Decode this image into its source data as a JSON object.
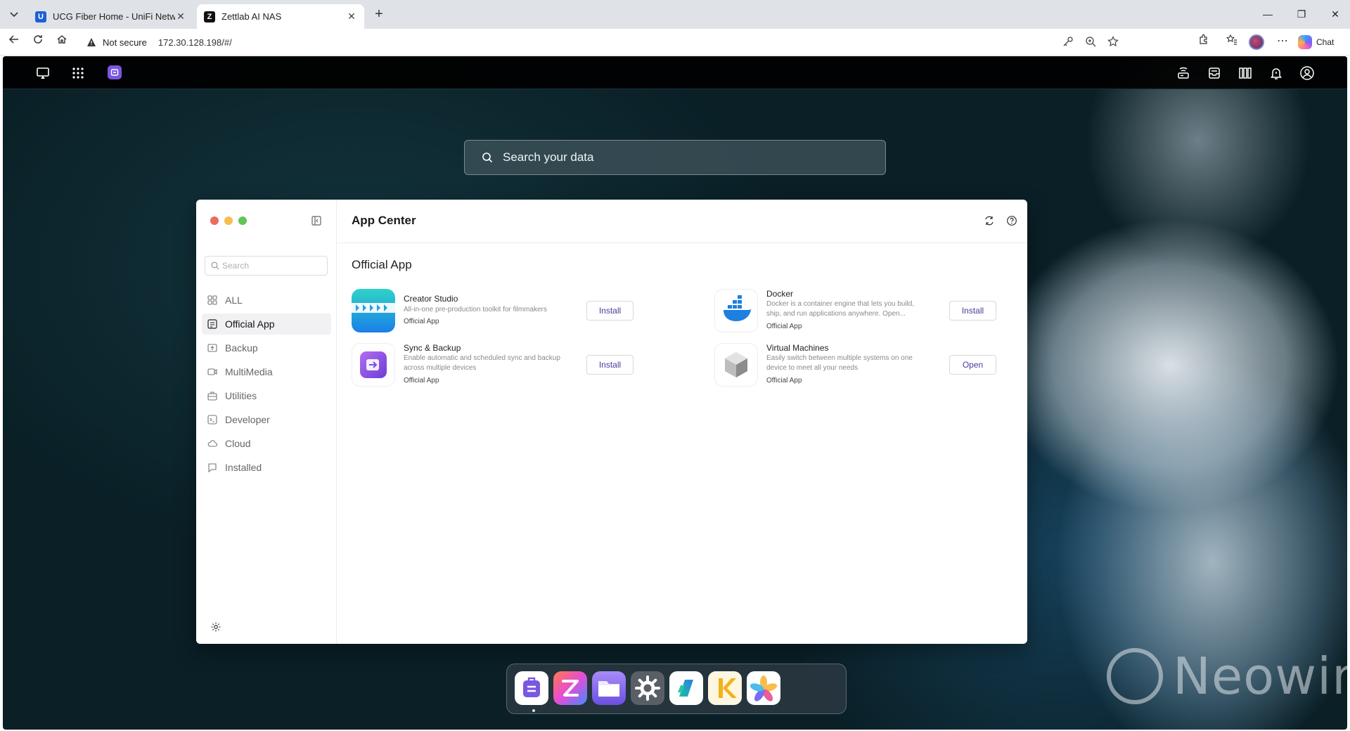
{
  "browser": {
    "tabs": [
      {
        "title": "UCG Fiber Home - UniFi Network",
        "favicon": "unifi-icon",
        "active": false
      },
      {
        "title": "Zettlab AI NAS",
        "favicon": "zettlab-icon",
        "active": true
      }
    ],
    "security_label": "Not secure",
    "url": "172.30.128.198/#/",
    "chat_label": "Chat"
  },
  "nas": {
    "search_placeholder": "Search your data",
    "watermark": "Neowin"
  },
  "app_center": {
    "title": "App Center",
    "sidebar_search_placeholder": "Search",
    "categories": [
      {
        "label": "ALL",
        "icon": "grid-icon",
        "active": false
      },
      {
        "label": "Official App",
        "icon": "official-app-icon",
        "active": true
      },
      {
        "label": "Backup",
        "icon": "backup-icon",
        "active": false
      },
      {
        "label": "MultiMedia",
        "icon": "multimedia-icon",
        "active": false
      },
      {
        "label": "Utilities",
        "icon": "utilities-icon",
        "active": false
      },
      {
        "label": "Developer",
        "icon": "developer-icon",
        "active": false
      },
      {
        "label": "Cloud",
        "icon": "cloud-icon",
        "active": false
      },
      {
        "label": "Installed",
        "icon": "installed-icon",
        "active": false
      }
    ],
    "section_title": "Official App",
    "apps": [
      {
        "name": "Creator Studio",
        "description": "All-in-one pre-production toolkit for filmmakers",
        "tag": "Official App",
        "action": "Install"
      },
      {
        "name": "Docker",
        "description": "Docker is a container engine that lets you build, ship, and run applications anywhere. Open...",
        "tag": "Official App",
        "action": "Install"
      },
      {
        "name": "Sync & Backup",
        "description": "Enable automatic and scheduled sync and backup across multiple devices",
        "tag": "Official App",
        "action": "Install"
      },
      {
        "name": "Virtual Machines",
        "description": "Easily switch between multiple systems on one device to meet all your needs",
        "tag": "Official App",
        "action": "Open"
      }
    ]
  },
  "dock": {
    "items": [
      "app-center-icon",
      "zettlab-icon",
      "files-icon",
      "settings-icon",
      "tasks-icon",
      "k-app-icon",
      "photos-icon"
    ]
  },
  "colors": {
    "accent": "#7a57e0",
    "button_text": "#4b3a9a",
    "close_dot": "#ed6a5e",
    "minimize_dot": "#f5bf4f",
    "maximize_dot": "#61c554"
  }
}
